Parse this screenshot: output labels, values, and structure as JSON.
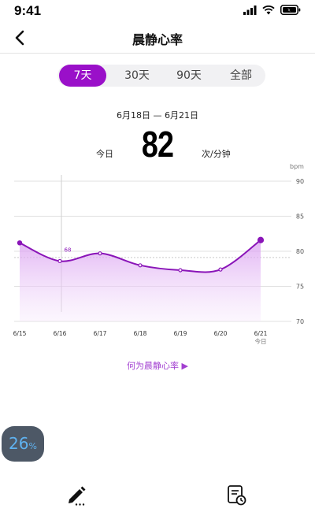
{
  "status_bar": {
    "time": "9:41",
    "icons": [
      "cellular-signal-icon",
      "wifi-icon",
      "battery-icon"
    ]
  },
  "nav": {
    "title": "晨静心率",
    "back_icon": "chevron-left-icon"
  },
  "range_tabs": [
    {
      "label": "7天",
      "active": true
    },
    {
      "label": "30天",
      "active": false
    },
    {
      "label": "90天",
      "active": false
    },
    {
      "label": "全部",
      "active": false
    }
  ],
  "summary": {
    "date_range": "6月18日 — 6月21日",
    "today_label": "今日",
    "value": "82",
    "unit": "次/分钟"
  },
  "chart_data": {
    "type": "area",
    "y_unit": "bpm",
    "ylim": [
      70,
      90
    ],
    "y_ticks": [
      "90",
      "85",
      "80",
      "75",
      "70"
    ],
    "x": [
      "6/15",
      "6/16",
      "6/17",
      "6/18",
      "6/19",
      "6/20",
      "6/21"
    ],
    "x_sublabels": [
      "",
      "",
      "",
      "",
      "",
      "",
      "今日"
    ],
    "values": [
      81.2,
      78.6,
      79.7,
      78.0,
      77.3,
      77.4,
      81.6
    ],
    "selected_index": 1,
    "selected_label": "68",
    "line_color": "#8a15b8",
    "fill_color": "#e3b6f3"
  },
  "explain_link": "何为晨静心率 ▶",
  "overlay_badge": {
    "value": "26",
    "unit": "%"
  },
  "bottom_bar": {
    "icons": [
      "edit-pen-icon",
      "report-clock-icon"
    ]
  },
  "colors": {
    "accent": "#9a10c9",
    "link": "#a23fd0",
    "badge_bg": "#4d5866",
    "badge_text": "#5fb2f0"
  }
}
